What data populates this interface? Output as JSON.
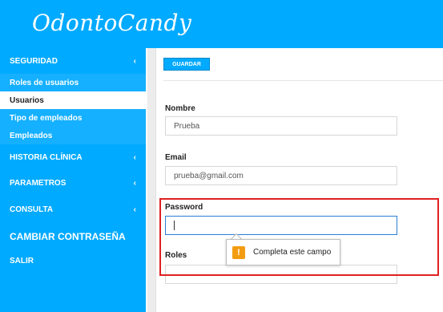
{
  "app": {
    "logo": "OdontoCandy"
  },
  "sidebar": {
    "sections": [
      {
        "label": "SEGURIDAD",
        "chevron": "‹"
      },
      {
        "label": "HISTORIA CLÍNICA",
        "chevron": "‹"
      },
      {
        "label": "PARAMETROS",
        "chevron": "‹"
      },
      {
        "label": "CONSULTA",
        "chevron": "‹"
      },
      {
        "label": "CAMBIAR CONTRASEÑA"
      },
      {
        "label": "SALIR"
      }
    ],
    "sub_items": [
      {
        "label": "Roles de usuarios"
      },
      {
        "label": "Usuarios"
      },
      {
        "label": "Tipo de empleados"
      },
      {
        "label": "Empleados"
      }
    ]
  },
  "toolbar": {
    "save_label": "GUARDAR"
  },
  "form": {
    "nombre": {
      "label": "Nombre",
      "value": "Prueba"
    },
    "email": {
      "label": "Email",
      "value": "prueba@gmail.com"
    },
    "password": {
      "label": "Password",
      "value": ""
    },
    "roles": {
      "label": "Roles",
      "value": ""
    }
  },
  "validation": {
    "message": "Completa este campo",
    "icon": "warning-icon"
  },
  "colors": {
    "brand": "#00aaff",
    "highlight": "#e02020",
    "warning": "#f39c12"
  }
}
